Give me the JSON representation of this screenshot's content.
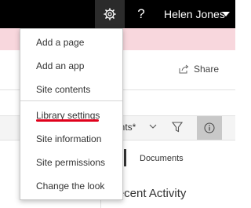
{
  "suite_bar": {
    "gear_icon": "gear-icon",
    "help_label": "?",
    "user_name": "Helen Jones",
    "caret_icon": "caret-down-icon"
  },
  "page": {
    "share_label": "Share",
    "view_label": "ents*",
    "documents_label": "Documents",
    "recent_activity_label": "Recent Activity"
  },
  "settings_menu": {
    "items": [
      {
        "label": "Add a page"
      },
      {
        "label": "Add an app"
      },
      {
        "label": "Site contents"
      },
      {
        "label": "Library settings"
      },
      {
        "label": "Site information"
      },
      {
        "label": "Site permissions"
      },
      {
        "label": "Change the look"
      }
    ]
  },
  "colors": {
    "suite_bar": "#000000",
    "notification_strip": "#f8d7dd",
    "highlight_underline": "#e0001b"
  }
}
